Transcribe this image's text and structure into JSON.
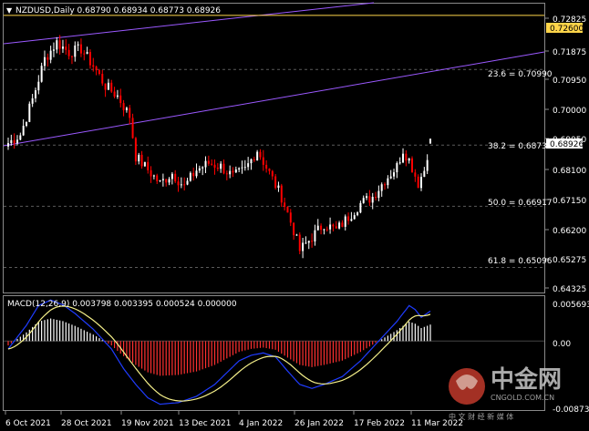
{
  "price_header": {
    "arrow": "▼",
    "text": "NZDUSD,Daily  0.68790 0.68934 0.68773 0.68926"
  },
  "macd_header": "MACD(12,26,9) 0.003798 0.003395 0.000524 0.000000",
  "colors": {
    "background": "#000000",
    "grid": "#5a5a5a",
    "bull": "#ffffff",
    "bear": "#ff0000",
    "channel": "#9b59ff",
    "level": "#ffd54a",
    "macd_line": "#1f3cff",
    "signal_line": "#f5f08a",
    "hist_pos": "#ffffff",
    "hist_neg": "#ff3030"
  },
  "price_axis": [
    "0.72825",
    "0.71875",
    "0.70950",
    "0.70000",
    "0.69050",
    "0.68100",
    "0.67150",
    "0.66200",
    "0.65275",
    "0.64325"
  ],
  "macd_axis": [
    "0.005693",
    "0.00",
    "-0.008739"
  ],
  "date_labels": [
    "6 Oct 2021",
    "28 Oct 2021",
    "19 Nov 2021",
    "13 Dec 2021",
    "4 Jan 2022",
    "26 Jan 2022",
    "17 Feb 2022",
    "11 Mar 2022"
  ],
  "level_label": "0.72600",
  "current_price_label": "0.68926",
  "fib_labels": [
    "23.6 = 0.70990",
    "38.2 = 0.68737",
    "50.0 = 0.66917",
    "61.8 = 0.65096"
  ],
  "watermark": {
    "brand": "中金网",
    "url": "CNGOLD.COM.CN",
    "slogan": "中 文 财 经 新 媒 体"
  },
  "chart_data": {
    "type": "candlestick",
    "symbol": "NZDUSD",
    "timeframe": "Daily",
    "last_bar": {
      "open": 0.6879,
      "high": 0.68934,
      "low": 0.68773,
      "close": 0.68926
    },
    "ylim": [
      0.6435,
      0.7295
    ],
    "horizontal_levels": [
      0.726
    ],
    "fib_levels": [
      {
        "label": "23.6",
        "value": 0.7099
      },
      {
        "label": "38.2",
        "value": 0.68737
      },
      {
        "label": "50.0",
        "value": 0.66917
      },
      {
        "label": "61.8",
        "value": 0.65096
      }
    ],
    "anchors": [
      [
        0,
        0.688
      ],
      [
        4,
        0.6905
      ],
      [
        8,
        0.701
      ],
      [
        12,
        0.713
      ],
      [
        16,
        0.718
      ],
      [
        20,
        0.715
      ],
      [
        24,
        0.716
      ],
      [
        28,
        0.711
      ],
      [
        32,
        0.705
      ],
      [
        36,
        0.702
      ],
      [
        40,
        0.696
      ],
      [
        42,
        0.684
      ],
      [
        46,
        0.68
      ],
      [
        50,
        0.676
      ],
      [
        54,
        0.679
      ],
      [
        58,
        0.675
      ],
      [
        62,
        0.68
      ],
      [
        66,
        0.682
      ],
      [
        70,
        0.681
      ],
      [
        74,
        0.678
      ],
      [
        78,
        0.68
      ],
      [
        82,
        0.686
      ],
      [
        86,
        0.679
      ],
      [
        90,
        0.672
      ],
      [
        94,
        0.662
      ],
      [
        96,
        0.656
      ],
      [
        100,
        0.66
      ],
      [
        104,
        0.664
      ],
      [
        108,
        0.662
      ],
      [
        112,
        0.666
      ],
      [
        116,
        0.67
      ],
      [
        120,
        0.672
      ],
      [
        124,
        0.677
      ],
      [
        128,
        0.681
      ],
      [
        130,
        0.686
      ],
      [
        132,
        0.683
      ],
      [
        135,
        0.676
      ],
      [
        137,
        0.68
      ],
      [
        139,
        0.6893
      ]
    ],
    "macd": {
      "ylim": [
        -0.008739,
        0.005693
      ],
      "anchors": [
        [
          0,
          -0.001
        ],
        [
          6,
          0.002
        ],
        [
          10,
          0.0045
        ],
        [
          14,
          0.0052
        ],
        [
          18,
          0.0046
        ],
        [
          22,
          0.0035
        ],
        [
          28,
          0.0015
        ],
        [
          34,
          -0.001
        ],
        [
          38,
          -0.0035
        ],
        [
          42,
          -0.0055
        ],
        [
          46,
          -0.0072
        ],
        [
          50,
          -0.008
        ],
        [
          56,
          -0.0078
        ],
        [
          62,
          -0.007
        ],
        [
          68,
          -0.0055
        ],
        [
          72,
          -0.004
        ],
        [
          76,
          -0.0025
        ],
        [
          80,
          -0.0018
        ],
        [
          84,
          -0.0015
        ],
        [
          88,
          -0.002
        ],
        [
          92,
          -0.0038
        ],
        [
          96,
          -0.0055
        ],
        [
          100,
          -0.006
        ],
        [
          104,
          -0.0055
        ],
        [
          110,
          -0.0045
        ],
        [
          116,
          -0.0025
        ],
        [
          122,
          0.0
        ],
        [
          128,
          0.0025
        ],
        [
          132,
          0.0045
        ],
        [
          134,
          0.004
        ],
        [
          136,
          0.003
        ],
        [
          139,
          0.0038
        ]
      ]
    }
  }
}
